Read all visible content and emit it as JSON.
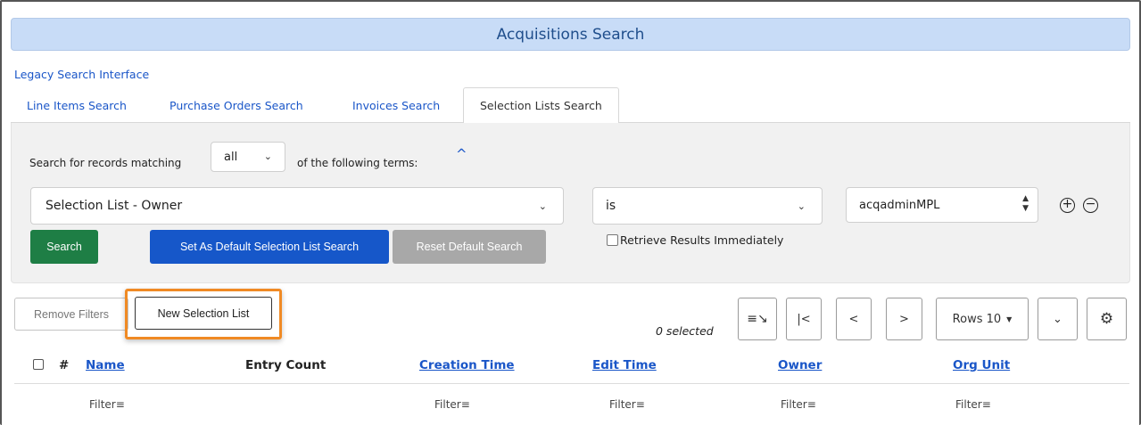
{
  "header": {
    "title": "Acquisitions Search"
  },
  "legacy_link": "Legacy Search Interface",
  "tabs": [
    {
      "label": "Line Items Search"
    },
    {
      "label": "Purchase Orders Search"
    },
    {
      "label": "Invoices Search"
    },
    {
      "label": "Selection Lists Search"
    }
  ],
  "search": {
    "match_prefix": "Search for records matching",
    "match_value": "all",
    "match_suffix": "of the following terms:",
    "field_value": "Selection List - Owner",
    "operator_value": "is",
    "term_value": "acqadminMPL",
    "search_label": "Search",
    "set_default_label": "Set As Default Selection List Search",
    "reset_default_label": "Reset Default Search",
    "retrieve_label": "Retrieve Results Immediately",
    "add_icon": "plus-circle-icon",
    "remove_icon": "minus-circle-icon"
  },
  "grid": {
    "remove_filters_label": "Remove Filters",
    "new_list_label": "New Selection List",
    "selected_text": "0 selected",
    "rows_label": "Rows 10",
    "columns": [
      {
        "label": "#"
      },
      {
        "label": "Name"
      },
      {
        "label": "Entry Count"
      },
      {
        "label": "Creation Time"
      },
      {
        "label": "Edit Time"
      },
      {
        "label": "Owner"
      },
      {
        "label": "Org Unit"
      }
    ],
    "filter_label": "Filter",
    "highlight_color": "#f08a24"
  }
}
